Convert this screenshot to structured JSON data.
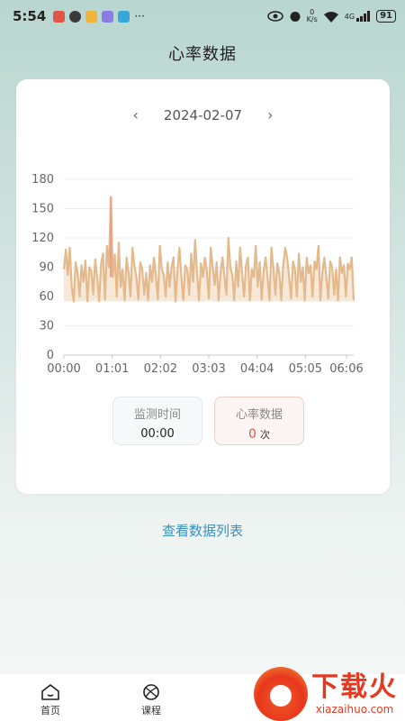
{
  "status_bar": {
    "time": "5:54",
    "network": "4G",
    "speed_unit": "K/s",
    "battery": "91"
  },
  "page_title": "心率数据",
  "date_nav": {
    "prev_icon": "chevron-left-icon",
    "date": "2024-02-07",
    "next_icon": "chevron-right-icon"
  },
  "chart_data": {
    "type": "area",
    "y_ticks": [
      0,
      30,
      60,
      90,
      120,
      150,
      180
    ],
    "ylim": [
      0,
      180
    ],
    "x_ticks": [
      "00:00",
      "01:01",
      "02:02",
      "03:03",
      "04:04",
      "05:05",
      "06:06"
    ],
    "xlim_minutes": [
      0,
      390
    ],
    "grid": true,
    "colors": {
      "fill": "#f0d6b8",
      "stroke": "#e4b98c",
      "spike": "#e8a08c"
    },
    "series": [
      {
        "values": [
          88,
          108,
          82,
          110,
          70,
          55,
          95,
          84,
          60,
          92,
          75,
          97,
          55,
          90,
          86,
          62,
          98,
          80,
          55,
          94,
          104,
          57,
          112,
          90,
          162,
          80,
          103,
          60,
          115,
          70,
          88,
          56,
          100,
          85,
          60,
          110,
          92,
          80,
          57,
          95,
          88,
          62,
          84,
          56,
          92,
          75,
          100,
          80,
          57,
          112,
          88,
          82,
          60,
          95,
          70,
          90,
          100,
          55,
          86,
          110,
          80,
          56,
          92,
          88,
          62,
          104,
          75,
          118,
          84,
          56,
          94,
          80,
          100,
          86,
          58,
          110,
          90,
          72,
          95,
          56,
          84,
          100,
          80,
          62,
          120,
          90,
          82,
          56,
          96,
          70,
          110,
          84,
          60,
          92,
          100,
          56,
          88,
          80,
          112,
          70,
          95,
          57,
          86,
          100,
          80,
          56,
          110,
          88,
          62,
          94,
          84,
          56,
          92,
          110,
          100,
          80,
          58,
          96,
          88,
          60,
          104,
          75,
          90,
          56,
          100,
          84,
          92,
          60,
          96,
          88,
          112,
          56,
          84,
          100,
          80,
          58,
          96,
          90,
          62,
          88,
          56,
          100,
          84,
          92,
          60,
          94,
          88,
          100,
          56
        ]
      }
    ]
  },
  "stats": {
    "monitor_label": "监测时间",
    "monitor_value": "00:00",
    "hr_label": "心率数据",
    "hr_value": "0",
    "hr_unit": "次"
  },
  "view_list_link": "查看数据列表",
  "tabs": [
    {
      "label": "首页",
      "icon": "home-icon"
    },
    {
      "label": "课程",
      "icon": "ball-icon"
    }
  ],
  "watermark": {
    "cn": "下载火",
    "url": "xiazaihuo.com"
  }
}
